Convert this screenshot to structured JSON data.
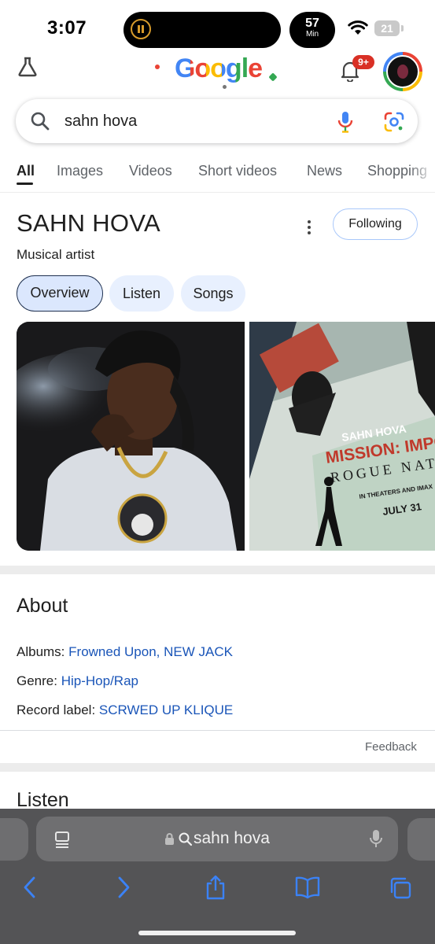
{
  "status_bar": {
    "time": "3:07",
    "timer_value": "57",
    "timer_unit": "Min",
    "battery": "21"
  },
  "google_header": {
    "doodle_text": "Google",
    "notification_count": "9+"
  },
  "search": {
    "query": "sahn hova"
  },
  "tabs": [
    {
      "label": "All",
      "selected": true
    },
    {
      "label": "Images"
    },
    {
      "label": "Videos"
    },
    {
      "label": "Short videos"
    },
    {
      "label": "News"
    },
    {
      "label": "Shopping"
    }
  ],
  "knowledge_panel": {
    "title": "SAHN HOVA",
    "subtitle": "Musical artist",
    "follow_label": "Following",
    "chips": [
      {
        "label": "Overview",
        "selected": true
      },
      {
        "label": "Listen"
      },
      {
        "label": "Songs"
      }
    ],
    "poster_text": {
      "artist": "SAHN HOVA",
      "line1": "MISSION: IMPOSSI",
      "line2": "ROGUE NATI",
      "line3": "IN THEATERS AND IMAX",
      "line4": "JULY 31"
    }
  },
  "about": {
    "heading": "About",
    "facts": [
      {
        "label": "Albums:",
        "links": [
          "Frowned Upon",
          "NEW JACK"
        ],
        "separator": ", "
      },
      {
        "label": "Genre:",
        "links": [
          "Hip-Hop/Rap"
        ]
      },
      {
        "label": "Record label:",
        "links": [
          "SCRWED UP KLIQUE"
        ]
      }
    ],
    "feedback": "Feedback"
  },
  "listen_section": {
    "heading": "Listen"
  },
  "safari": {
    "url_text": "sahn hova"
  },
  "colors": {
    "link": "#1a55b8",
    "chip_bg": "#e8f0fe",
    "toolbar_bg": "#545456",
    "toolbar_icon": "#3b82f6"
  }
}
